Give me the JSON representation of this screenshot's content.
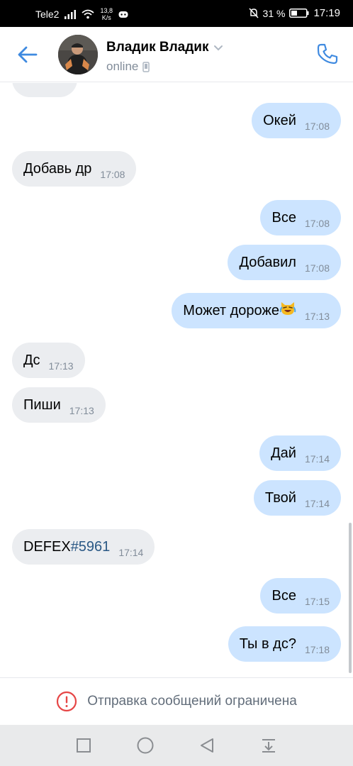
{
  "status_bar": {
    "carrier": "Tele2",
    "speed_value": "13,8",
    "speed_unit": "K/s",
    "battery": "31 %",
    "time": "17:19"
  },
  "header": {
    "contact_name": "Владик Владик",
    "status": "online"
  },
  "messages": [
    {
      "dir": "out",
      "text": "Окей",
      "time": "17:08"
    },
    {
      "dir": "in",
      "text": "Добавь др",
      "time": "17:08"
    },
    {
      "dir": "out",
      "text": "Все",
      "time": "17:08"
    },
    {
      "dir": "out",
      "text": "Добавил",
      "time": "17:08"
    },
    {
      "dir": "out",
      "text": "Может дороже",
      "emoji": "crying-laughing-cat",
      "time": "17:13"
    },
    {
      "dir": "in",
      "text": "Дс",
      "time": "17:13"
    },
    {
      "dir": "in",
      "text": "Пиши",
      "time": "17:13"
    },
    {
      "dir": "out",
      "text": "Дай",
      "time": "17:14"
    },
    {
      "dir": "out",
      "text": "Твой",
      "time": "17:14"
    },
    {
      "dir": "in",
      "text": "DEFEX",
      "hashtag": "#5961",
      "time": "17:14"
    },
    {
      "dir": "out",
      "text": "Все",
      "time": "17:15"
    },
    {
      "dir": "out",
      "text": "Ты в дс?",
      "time": "17:18"
    }
  ],
  "restriction": {
    "text": "Отправка сообщений ограничена"
  },
  "colors": {
    "accent": "#3f8ae0",
    "incoming_bubble": "#ebedf0",
    "outgoing_bubble": "#cce4ff",
    "secondary_text": "#818c99",
    "hashtag": "#2a5885",
    "warning": "#e64646"
  },
  "icons": {
    "back": "arrow-left-icon",
    "call": "phone-icon",
    "chevron": "chevron-down-icon",
    "mobile": "phone-device-icon",
    "warning": "exclamation-circle-icon",
    "nav_recent": "square-icon",
    "nav_home": "circle-icon",
    "nav_back": "triangle-back-icon",
    "nav_notifications": "pull-down-icon"
  }
}
